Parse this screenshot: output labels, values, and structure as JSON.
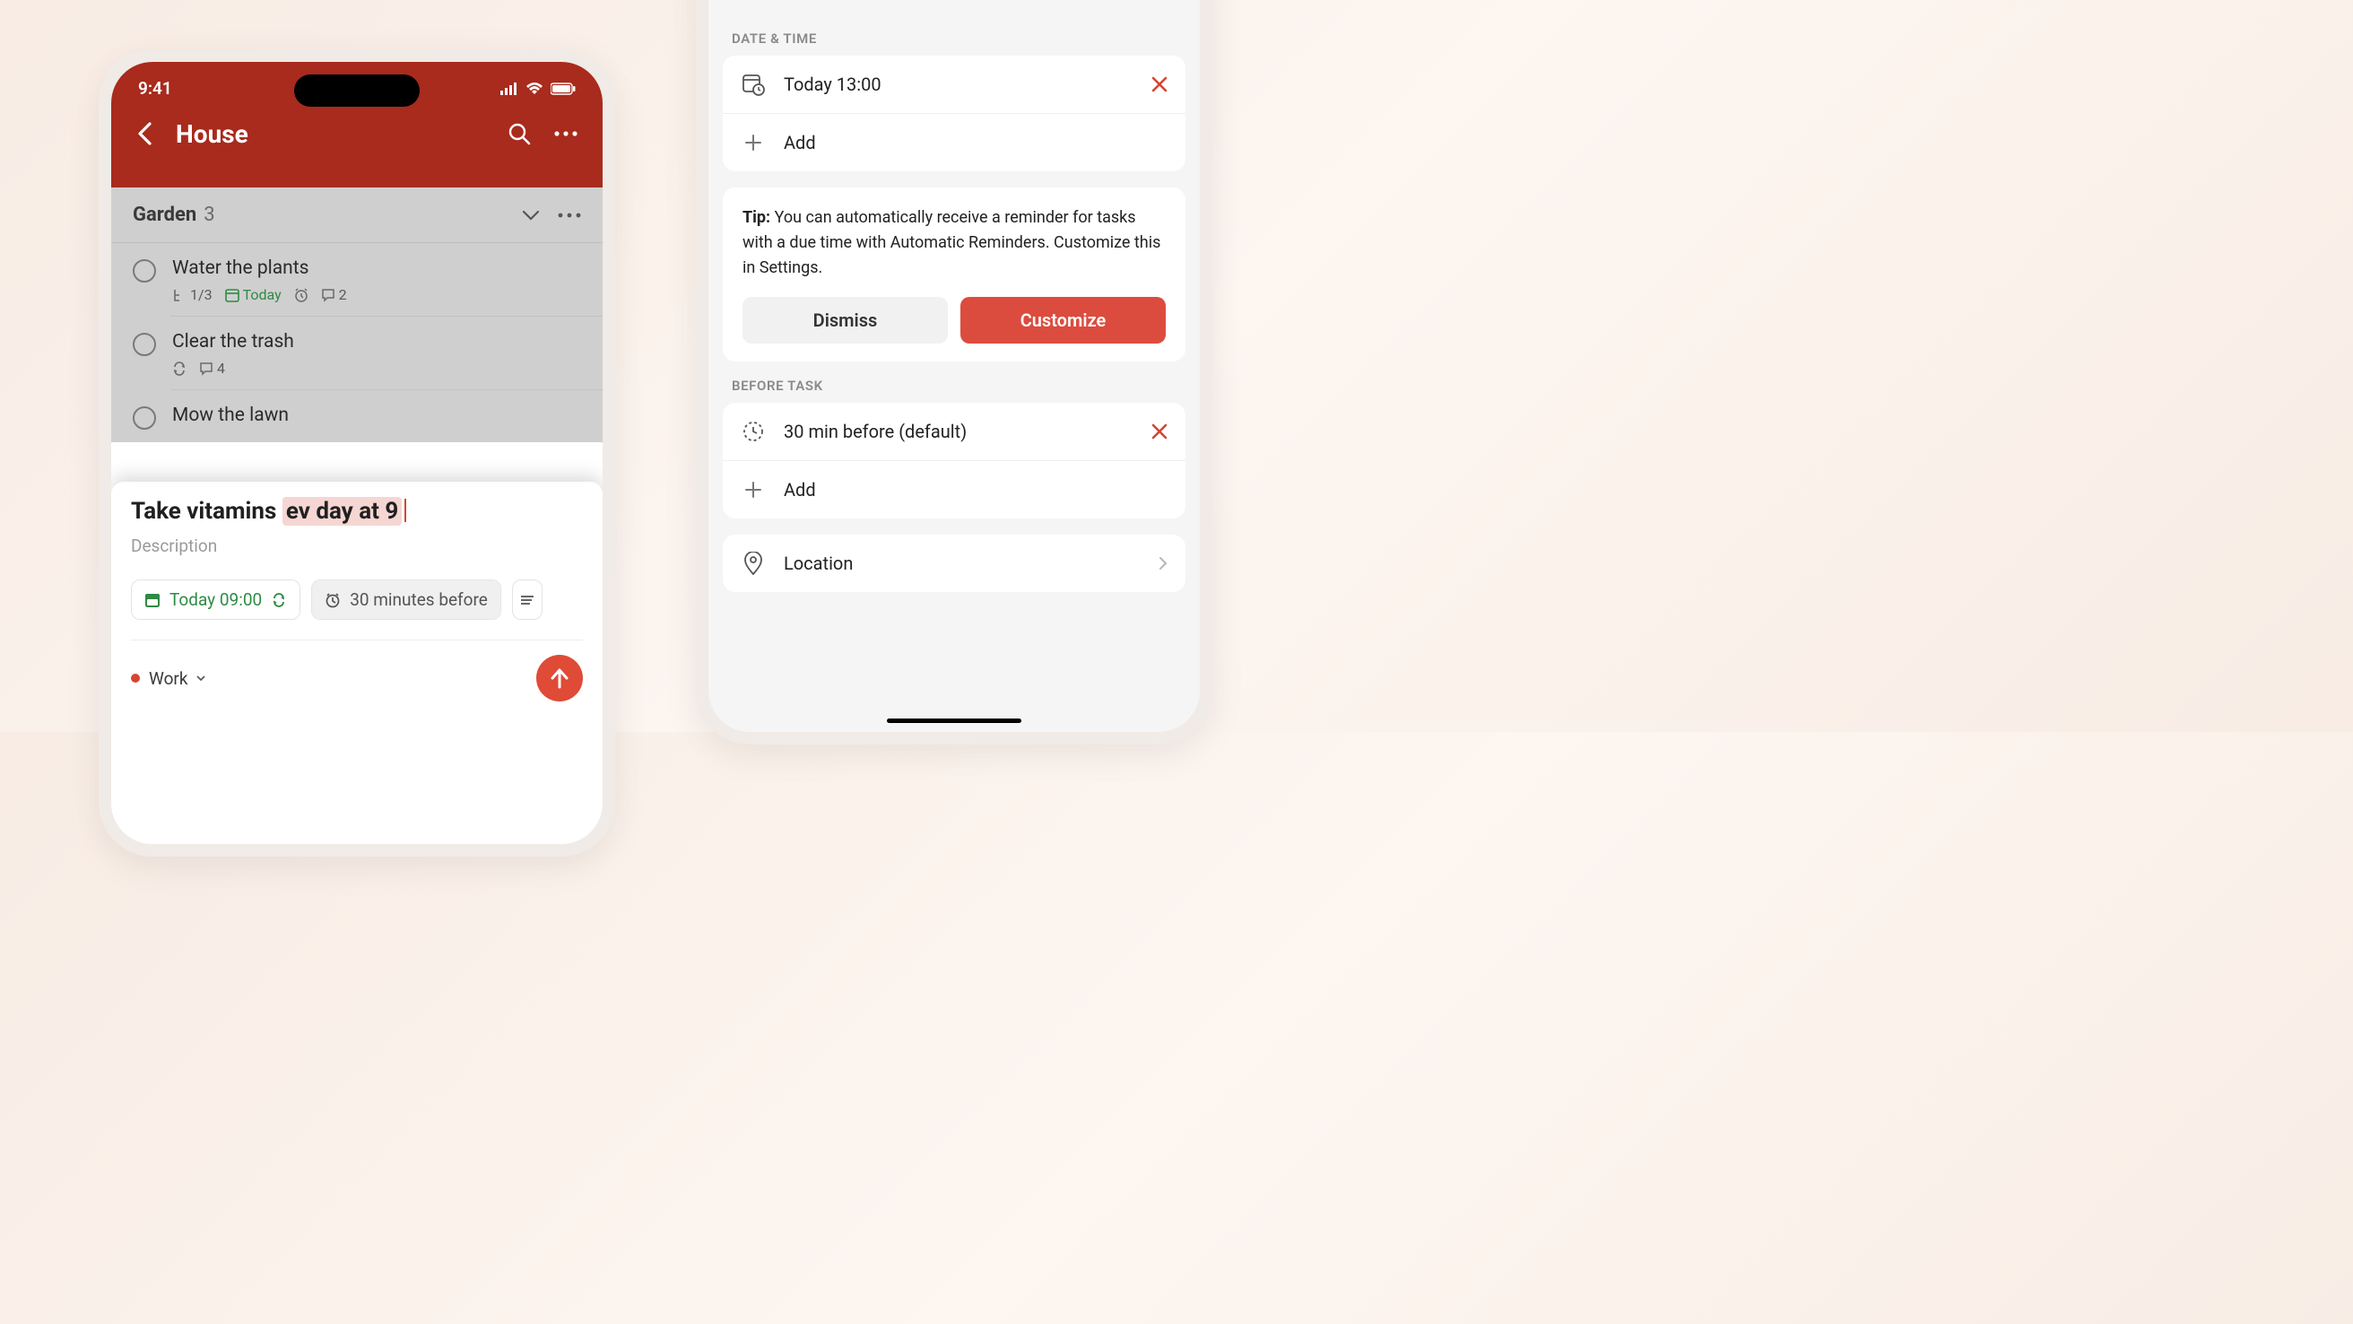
{
  "left": {
    "status": {
      "time": "9:41"
    },
    "nav": {
      "title": "House"
    },
    "section": {
      "title": "Garden",
      "count": "3"
    },
    "tasks": [
      {
        "title": "Water the plants",
        "subtasks": "1/3",
        "date": "Today",
        "comments": "2"
      },
      {
        "title": "Clear the trash",
        "comments": "4"
      },
      {
        "title": "Mow the lawn"
      }
    ],
    "quickadd": {
      "title_plain": "Take vitamins ",
      "title_hl": "ev day at 9",
      "desc_placeholder": "Description",
      "chip_date": "Today 09:00",
      "chip_reminder": "30 minutes before",
      "project": "Work"
    }
  },
  "right": {
    "sections": {
      "date_time": "DATE & TIME",
      "before_task": "BEFORE TASK"
    },
    "datetime": {
      "value": "Today 13:00",
      "add": "Add"
    },
    "tip": {
      "prefix": "Tip:",
      "body": " You can automatically receive a reminder for tasks with a due time with Automatic Reminders. Customize this in Settings.",
      "dismiss": "Dismiss",
      "customize": "Customize"
    },
    "before": {
      "value": "30 min before (default)",
      "add": "Add"
    },
    "location": "Location"
  },
  "colors": {
    "accent": "#dc4c3e",
    "header": "#a82b1d",
    "green": "#2e8b44"
  }
}
